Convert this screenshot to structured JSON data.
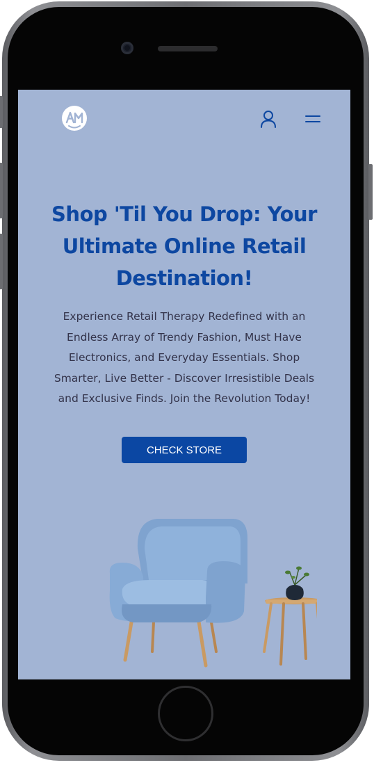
{
  "header": {
    "logo_icon": "brand-logo-icon",
    "account_icon": "user-icon",
    "menu_icon": "hamburger-menu-icon"
  },
  "hero": {
    "headline_lines": [
      "Shop 'Til You Drop: Your",
      "Ultimate Online Retail",
      "Destination!"
    ],
    "description_lines": [
      "Experience Retail Therapy Redefined with an",
      "Endless Array of Trendy Fashion, Must Have",
      "Electronics, and Everyday Essentials. Shop",
      "Smarter, Live Better - Discover Irresistible Deals",
      "and Exclusive Finds. Join the Revolution Today!"
    ],
    "cta_label": "CHECK STORE",
    "image_subject": "blue-armchair-with-side-table-and-plant"
  },
  "colors": {
    "screen_background": "#a2b4d4",
    "brand_blue": "#0d47a1",
    "button_blue": "#0b47a3",
    "body_text": "#33334a"
  }
}
